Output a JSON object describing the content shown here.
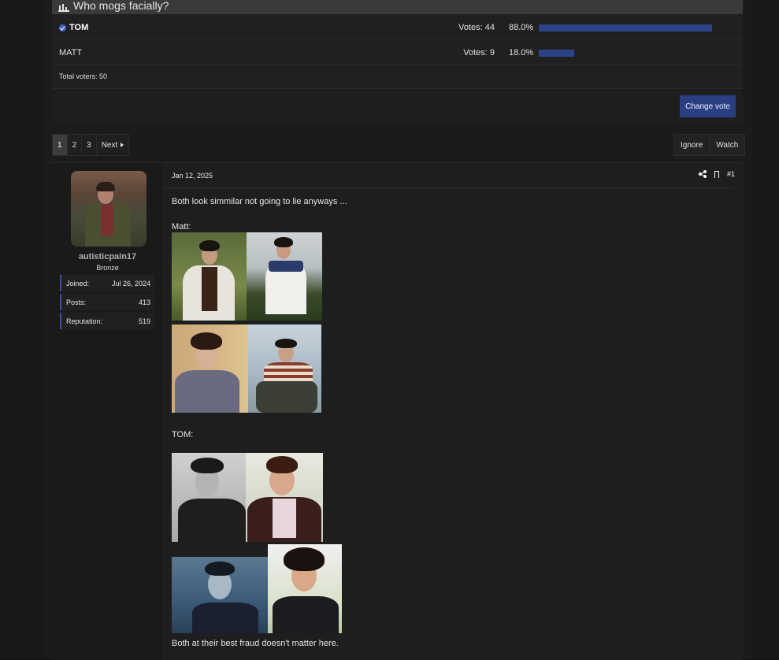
{
  "poll": {
    "title": "Who mogs facially?",
    "options": [
      {
        "label": "TOM",
        "voted": true,
        "votes_text": "Votes: 44",
        "percent_text": "88.0%",
        "percent": 88.0
      },
      {
        "label": "MATT",
        "voted": false,
        "votes_text": "Votes: 9",
        "percent_text": "18.0%",
        "percent": 18.0
      }
    ],
    "total_voters": "Total voters: 50",
    "change_vote_label": "Change vote"
  },
  "pagination": {
    "pages": [
      "1",
      "2",
      "3"
    ],
    "current": "1",
    "next_label": "Next"
  },
  "thread_actions": {
    "ignore_label": "Ignore",
    "watch_label": "Watch"
  },
  "post": {
    "date": "Jan 12, 2025",
    "number": "#1",
    "author": {
      "username": "autisticpain17",
      "rank": "Bronze",
      "stats": [
        {
          "label": "Joined:",
          "value": "Jul 26, 2024"
        },
        {
          "label": "Posts:",
          "value": "413"
        },
        {
          "label": "Reputation:",
          "value": "519"
        }
      ]
    },
    "intro_text": "Both look simmilar not going to lie anyways ...",
    "matt_label": "Matt:",
    "tom_label": "TOM:",
    "closing_text": "Both at their best fraud doesn't matter here."
  },
  "colors": {
    "accent": "#2c4487",
    "button": "#2a3f82",
    "background": "#1b1b1b"
  }
}
